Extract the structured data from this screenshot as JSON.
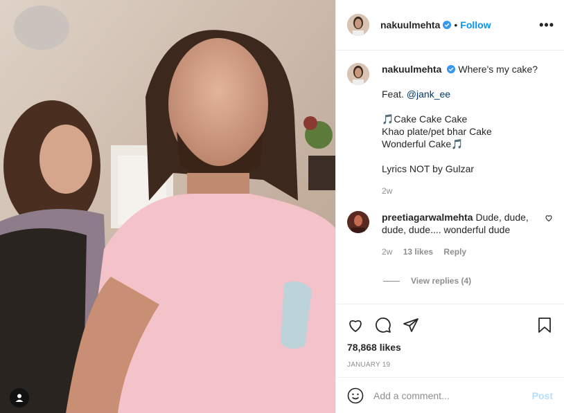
{
  "post": {
    "author": "nakuulmehta",
    "follow_label": "Follow",
    "separator": "•",
    "more_label": "•••",
    "caption_lines": [
      "Where's my cake?"
    ],
    "caption_feat_prefix": "Feat. ",
    "caption_mention": "@jank_ee",
    "caption_song": [
      "🎵Cake Cake Cake",
      "Khao plate/pet bhar Cake",
      "Wonderful Cake🎵"
    ],
    "caption_lyrics": "Lyrics NOT by Gulzar",
    "caption_time": "2w",
    "likes": "78,868 likes",
    "date": "JANUARY 19"
  },
  "comment": {
    "user": "preetiagarwalmehta",
    "text": "Dude, dude, dude, dude.... wonderful dude",
    "time": "2w",
    "likes": "13 likes",
    "reply_label": "Reply",
    "view_replies": "View replies (4)"
  },
  "add_comment": {
    "placeholder": "Add a comment...",
    "post_label": "Post"
  },
  "icons": [
    "heart-icon",
    "comment-icon",
    "share-icon",
    "bookmark-icon",
    "emoji-icon",
    "user-tag-icon",
    "verified-icon"
  ],
  "colors": {
    "link": "#0095f6",
    "post_disabled": "#b2dffc",
    "muted": "#8e8e8e"
  }
}
